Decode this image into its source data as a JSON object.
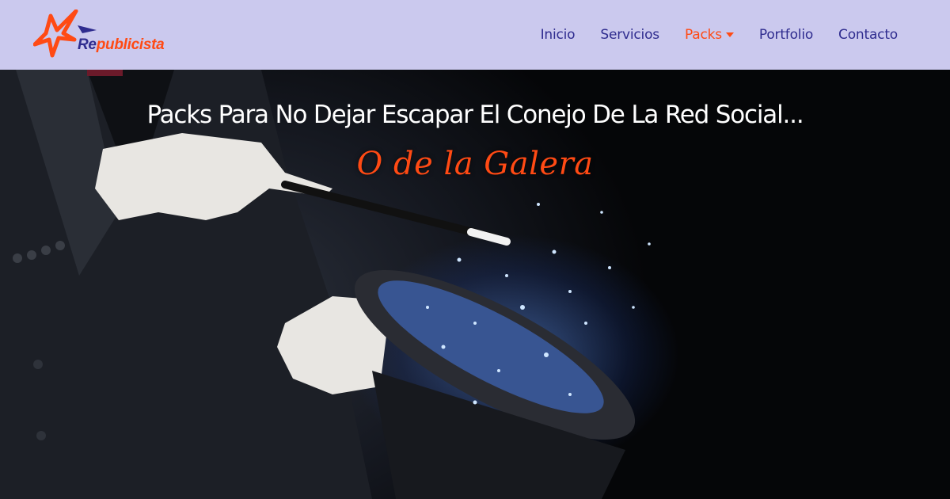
{
  "brand": {
    "prefix": "Re",
    "suffix": "publicista",
    "colors": {
      "primary": "#2f2c8f",
      "accent": "#ff4a14",
      "header_bg": "#cbc9ee"
    }
  },
  "nav": {
    "items": [
      {
        "label": "Inicio",
        "active": false
      },
      {
        "label": "Servicios",
        "active": false
      },
      {
        "label": "Packs",
        "active": true,
        "dropdown": true
      },
      {
        "label": "Portfolio",
        "active": false
      },
      {
        "label": "Contacto",
        "active": false
      }
    ]
  },
  "hero": {
    "headline": "Packs Para No Dejar Escapar El Conejo De La Red Social...",
    "subheadline": "O de la Galera",
    "image_subject": "magician-wand-top-hat"
  }
}
